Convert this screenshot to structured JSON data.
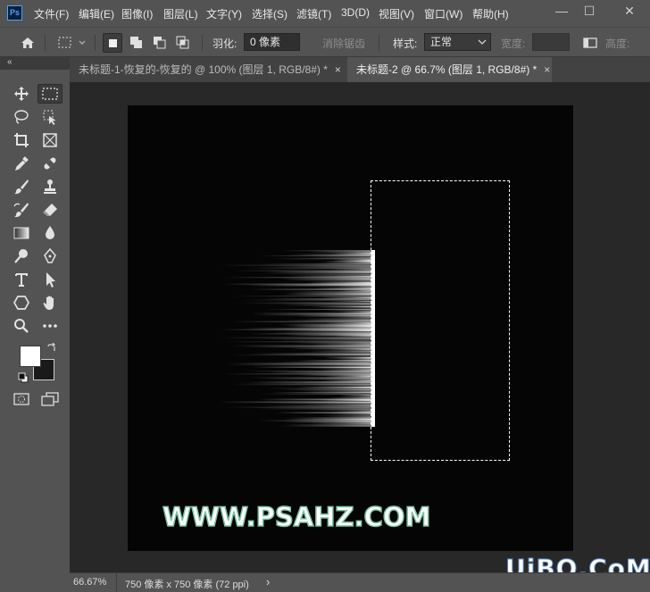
{
  "app": {
    "logo_text": "Ps"
  },
  "menu": [
    "文件(F)",
    "编辑(E)",
    "图像(I)",
    "图层(L)",
    "文字(Y)",
    "选择(S)",
    "滤镜(T)",
    "3D(D)",
    "视图(V)",
    "窗口(W)",
    "帮助(H)"
  ],
  "window_controls": {
    "minimize": "—",
    "maximize": "☐",
    "close": "✕"
  },
  "options": {
    "feather_label": "羽化:",
    "feather_value": "0 像素",
    "antialias_label": "消除锯齿",
    "style_label": "样式:",
    "style_value": "正常",
    "width_label": "宽度:",
    "height_label": "高度:"
  },
  "tabs": [
    {
      "title": "未标题-1-恢复的-恢复的 @ 100% (图层 1, RGB/8#) *",
      "close": "×",
      "active": false
    },
    {
      "title": "未标题-2 @ 66.7% (图层 1, RGB/8#) *",
      "close": "×",
      "active": true
    }
  ],
  "toolbar": {
    "collapse": "«"
  },
  "canvas": {
    "watermark": "WWW.PSAHZ.COM",
    "brand": "UiBQ.CoM"
  },
  "status": {
    "zoom": "66.67%",
    "doc_info": "750 像素 x 750 像素 (72 ppi)",
    "arrow": "›"
  },
  "colors": {
    "foreground": "#ffffff",
    "background": "#1a1a1a",
    "accent": "#4aa3ff"
  }
}
